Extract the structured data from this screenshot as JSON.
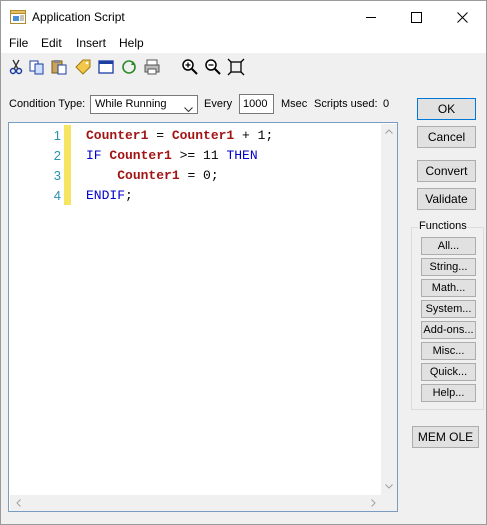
{
  "window": {
    "title": "Application Script",
    "icon": "script-window-icon"
  },
  "menu": [
    "File",
    "Edit",
    "Insert",
    "Help"
  ],
  "toolbar": {
    "icons": [
      "cut-icon",
      "copy-icon",
      "paste-icon",
      "tag-icon",
      "window-icon",
      "refresh-icon",
      "print-icon",
      "zoom-in-icon",
      "zoom-out-icon",
      "fit-icon"
    ]
  },
  "condition": {
    "type_label": "Condition Type:",
    "type_value": "While Running",
    "every_label": "Every",
    "every_value": "1000",
    "msec_label": "Msec",
    "scripts_used_label": "Scripts used:",
    "scripts_used_value": "0"
  },
  "editor": {
    "lines": [
      {
        "num": "1",
        "tokens": [
          [
            "var",
            "Counter1"
          ],
          [
            "op",
            " = "
          ],
          [
            "var",
            "Counter1"
          ],
          [
            "op",
            " + 1;"
          ]
        ]
      },
      {
        "num": "2",
        "tokens": [
          [
            "kw",
            "IF "
          ],
          [
            "var",
            "Counter1"
          ],
          [
            "op",
            " >= 11 "
          ],
          [
            "kw",
            "THEN"
          ]
        ]
      },
      {
        "num": "3",
        "tokens": [
          [
            "op",
            "    "
          ],
          [
            "var",
            "Counter1"
          ],
          [
            "op",
            " = 0;"
          ]
        ]
      },
      {
        "num": "4",
        "tokens": [
          [
            "kw",
            "ENDIF"
          ],
          [
            "op",
            ";"
          ]
        ]
      }
    ]
  },
  "buttons": {
    "ok": "OK",
    "cancel": "Cancel",
    "convert": "Convert",
    "validate": "Validate",
    "mem_ole": "MEM OLE"
  },
  "functions": {
    "label": "Functions",
    "items": [
      "All...",
      "String...",
      "Math...",
      "System...",
      "Add-ons...",
      "Misc...",
      "Quick...",
      "Help..."
    ]
  },
  "colors": {
    "keyword": "#0000cc",
    "variable": "#a31515",
    "line_number": "#2b91af",
    "gutter_marker": "#f5e560",
    "default_button_border": "#0078d7"
  }
}
